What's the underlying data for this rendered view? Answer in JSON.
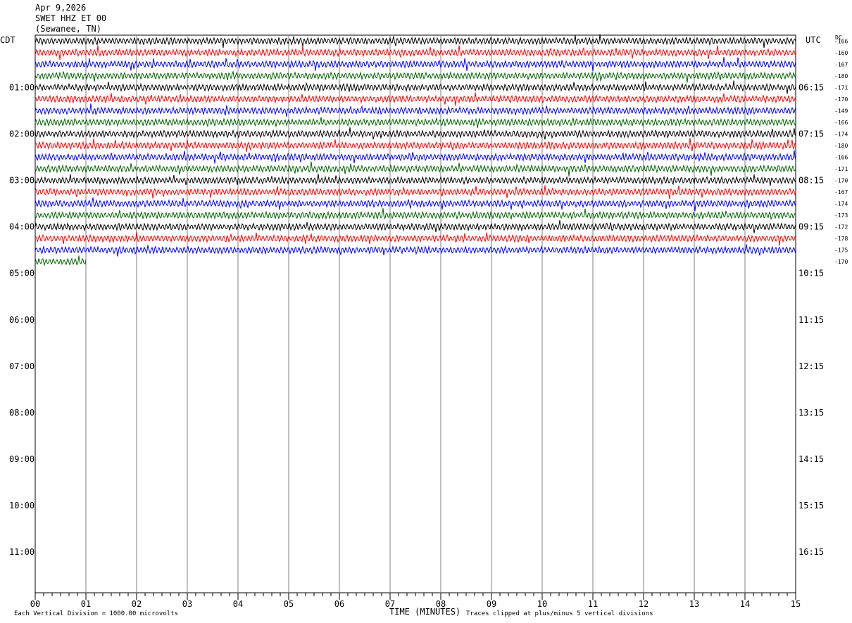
{
  "header": {
    "date": "Apr 9,2026",
    "station": "SWET HHZ ET 00",
    "location": "(Sewanee, TN)"
  },
  "labels": {
    "left_tz": "CDT",
    "right_tz": "UTC",
    "dc": "DC",
    "xlabel": "TIME (MINUTES)",
    "scale_note": "Each Vertical Division = 1000.00 microvolts",
    "clip_note": "Traces clipped at plus/minus 5 vertical divisions"
  },
  "chart_data": {
    "type": "line",
    "x_ticks": [
      "00",
      "01",
      "02",
      "03",
      "04",
      "05",
      "06",
      "07",
      "08",
      "09",
      "10",
      "11",
      "12",
      "13",
      "14",
      "15"
    ],
    "xlim": [
      0,
      15
    ],
    "left_hour_labels": [
      "01:00",
      "02:00",
      "03:00",
      "04:00",
      "05:00",
      "06:00",
      "07:00",
      "08:00",
      "09:00",
      "10:00",
      "11:00"
    ],
    "right_hour_labels": [
      "06:15",
      "07:15",
      "08:15",
      "09:15",
      "10:15",
      "11:15",
      "12:15",
      "13:15",
      "14:15",
      "15:15",
      "16:15"
    ],
    "dc_offsets": [
      "-166",
      "-160",
      "-167",
      "-180",
      "-171",
      "-170",
      "-149",
      "-166",
      "-174",
      "-180",
      "-166",
      "-171",
      "-170",
      "-167",
      "-174",
      "-173",
      "-172",
      "-178",
      "-175",
      "-170"
    ],
    "trace_colors": [
      "#000000",
      "#ff0000",
      "#0000ff",
      "#006400"
    ],
    "traces_total_rows": 48,
    "traces_recorded": 20,
    "last_trace_end_minute": 1.0
  }
}
